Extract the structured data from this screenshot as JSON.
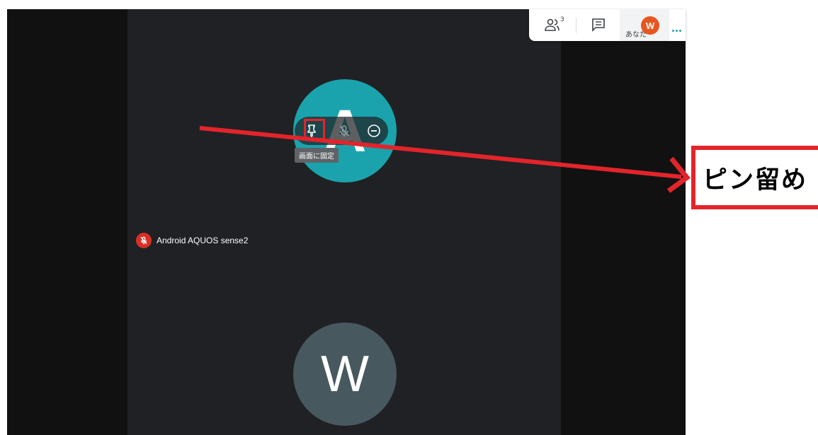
{
  "colors": {
    "accent_teal": "#1aa3ad",
    "avatar_gray": "#47585f",
    "muted_red": "#d93025",
    "annotation_red": "#e3242b",
    "self_avatar_orange": "#e8561f"
  },
  "participants": {
    "first": {
      "initial": "A",
      "name": "Android AQUOS sense2"
    },
    "second": {
      "initial": "W"
    }
  },
  "hover_controls": {
    "pin_icon": "pin-icon",
    "mic_icon": "mic-off-icon",
    "remove_icon": "remove-circle-icon",
    "pin_tooltip": "画面に固定"
  },
  "top_panel": {
    "people_icon": "people-icon",
    "people_count": "3",
    "chat_icon": "chat-icon",
    "self_initial": "W",
    "self_label": "あなた",
    "more_icon": "more-dots-icon"
  },
  "annotation": {
    "callout_text": "ピン留め"
  }
}
